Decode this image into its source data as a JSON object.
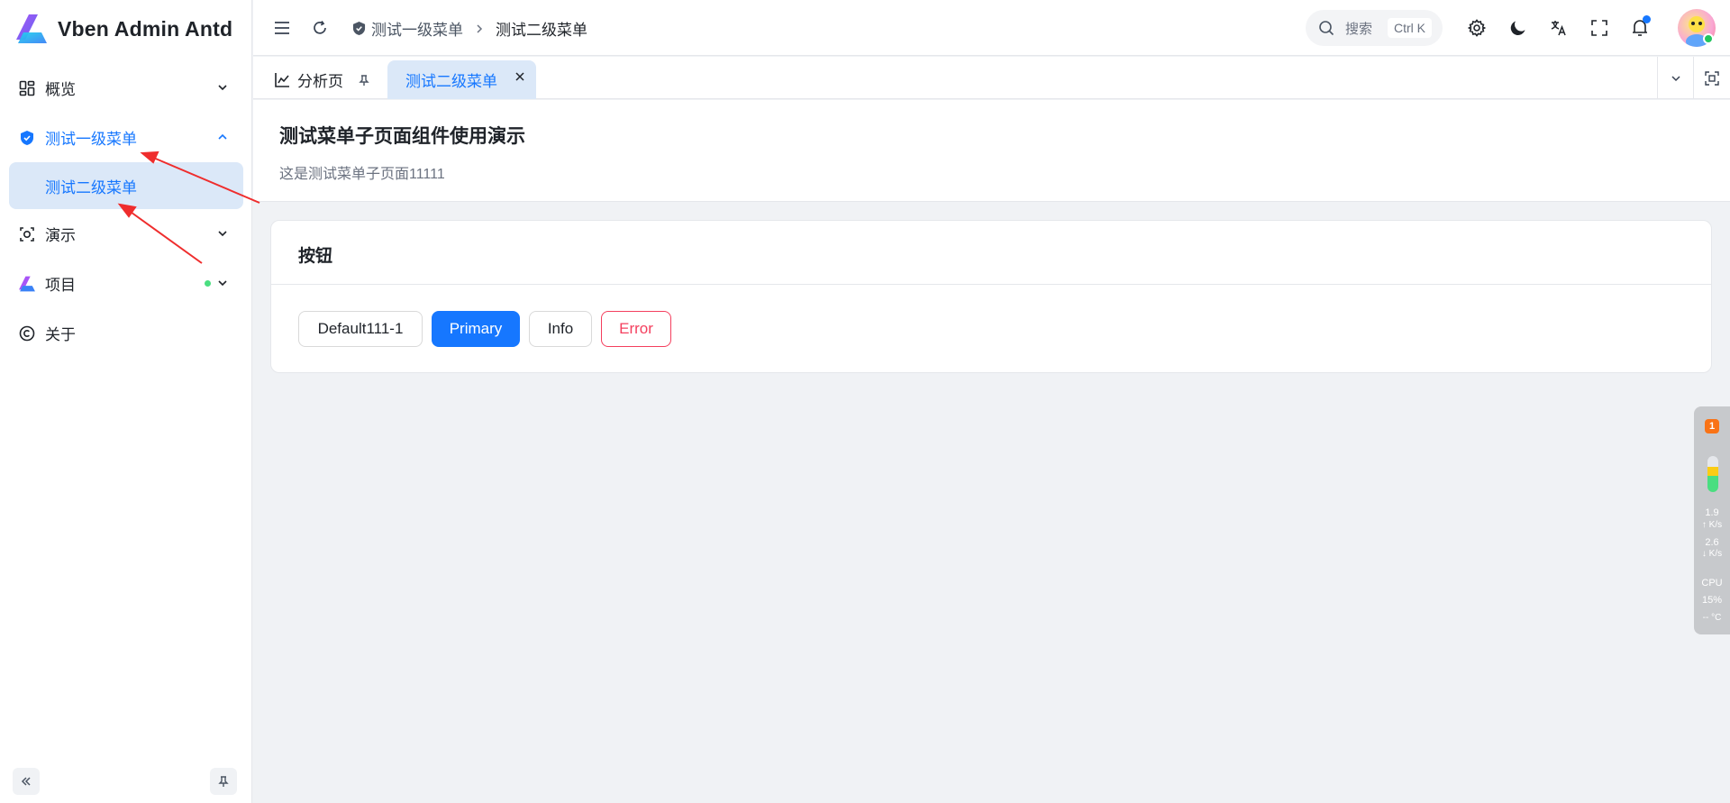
{
  "app": {
    "title": "Vben Admin Antd"
  },
  "sidebar": {
    "items": [
      {
        "label": "概览",
        "icon": "dashboard-icon",
        "expanded": false
      },
      {
        "label": "测试一级菜单",
        "icon": "location-shield-icon",
        "expanded": true,
        "active": true,
        "children": [
          {
            "label": "测试二级菜单",
            "active": true
          }
        ]
      },
      {
        "label": "演示",
        "icon": "demo-icon",
        "expanded": false
      },
      {
        "label": "项目",
        "icon": "vben-logo-icon",
        "expanded": false,
        "has_dot": true
      },
      {
        "label": "关于",
        "icon": "copyright-icon"
      }
    ]
  },
  "header": {
    "breadcrumb": [
      "测试一级菜单",
      "测试二级菜单"
    ],
    "search": {
      "placeholder": "搜索",
      "shortcut": "Ctrl K"
    }
  },
  "tabs": [
    {
      "label": "分析页",
      "icon": "chart-line-icon",
      "pinned": true
    },
    {
      "label": "测试二级菜单",
      "active": true,
      "closable": true
    }
  ],
  "page": {
    "title": "测试菜单子页面组件使用演示",
    "description": "这是测试菜单子页面11111"
  },
  "card": {
    "title": "按钮",
    "buttons": {
      "default": "Default111-1",
      "primary": "Primary",
      "info": "Info",
      "error": "Error"
    }
  },
  "monitor": {
    "badge": "1",
    "upload_value": "1.9",
    "upload_unit": "K/s",
    "download_value": "2.6",
    "download_unit": "K/s",
    "cpu_label": "CPU",
    "cpu_value": "15%",
    "temp": "-- °C"
  },
  "colors": {
    "primary": "#1677ff",
    "error": "#f43f5e",
    "active_bg": "#dbe8f8",
    "annotation_arrow": "#ef2d2d"
  }
}
